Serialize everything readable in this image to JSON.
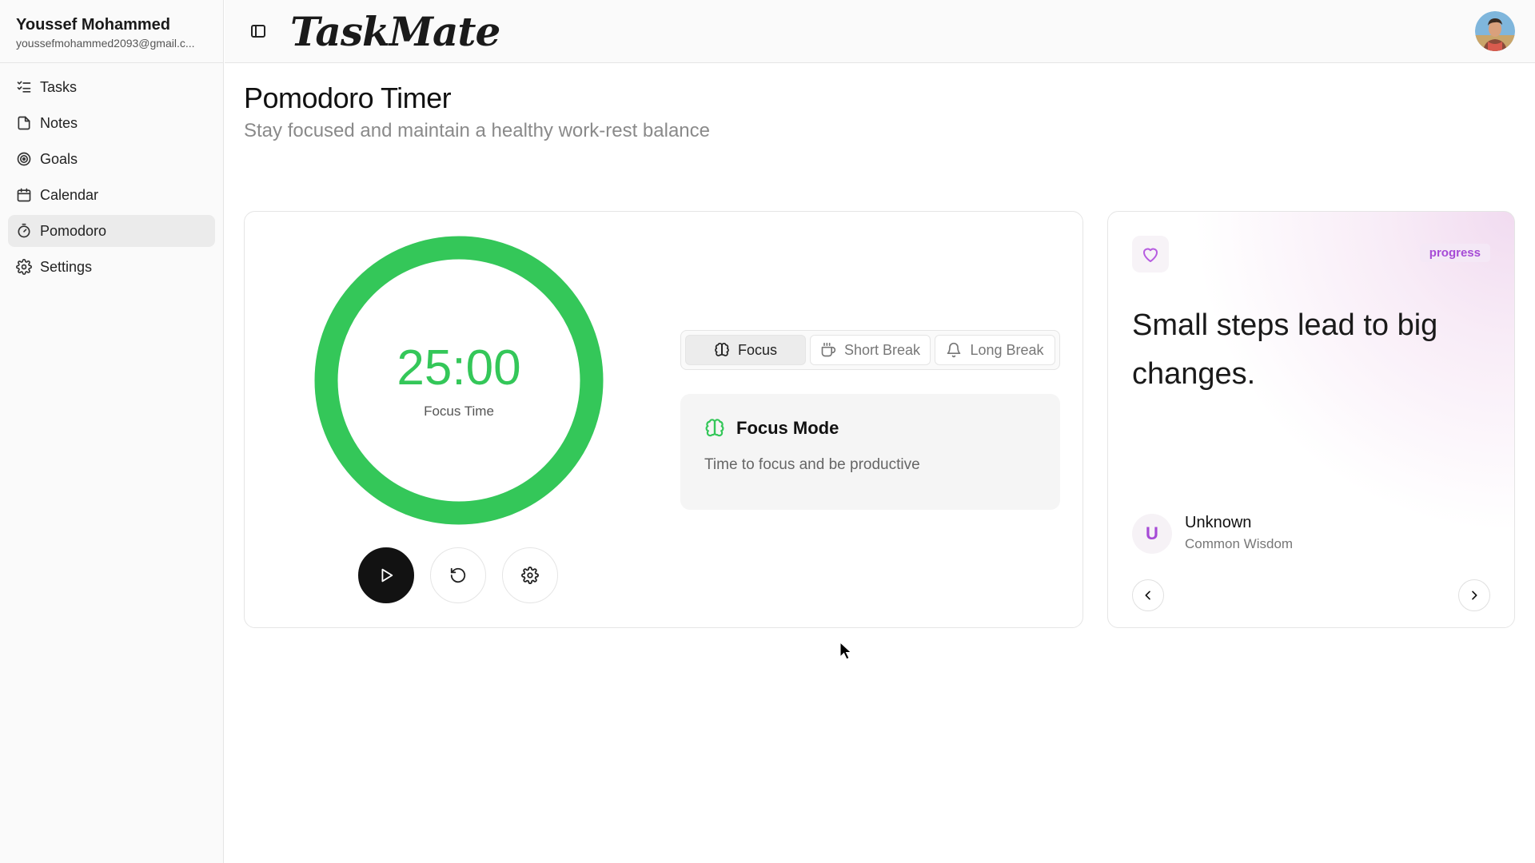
{
  "user": {
    "name": "Youssef Mohammed",
    "email": "youssefmohammed2093@gmail.c..."
  },
  "sidebar": {
    "items": [
      {
        "label": "Tasks",
        "icon": "list-check-icon",
        "active": false
      },
      {
        "label": "Notes",
        "icon": "file-icon",
        "active": false
      },
      {
        "label": "Goals",
        "icon": "target-icon",
        "active": false
      },
      {
        "label": "Calendar",
        "icon": "calendar-icon",
        "active": false
      },
      {
        "label": "Pomodoro",
        "icon": "timer-icon",
        "active": true
      },
      {
        "label": "Settings",
        "icon": "gear-icon",
        "active": false
      }
    ]
  },
  "header": {
    "logo": "TaskMate",
    "toggle_icon": "sidebar-toggle-icon",
    "avatar_icon": "user-avatar"
  },
  "page": {
    "title": "Pomodoro Timer",
    "subtitle": "Stay focused and maintain a healthy work-rest balance"
  },
  "timer": {
    "time": "25:00",
    "label": "Focus Time",
    "progress": 1.0,
    "ring_color": "#34c759",
    "controls": [
      "play-icon",
      "reset-icon",
      "gear-icon"
    ]
  },
  "modes": {
    "tabs": [
      {
        "label": "Focus",
        "icon": "brain-icon",
        "active": true
      },
      {
        "label": "Short Break",
        "icon": "coffee-icon",
        "active": false
      },
      {
        "label": "Long Break",
        "icon": "bell-icon",
        "active": false
      }
    ],
    "info": {
      "title": "Focus Mode",
      "description": "Time to focus and be productive",
      "icon": "brain-icon"
    }
  },
  "quote": {
    "tag": "progress",
    "text": "Small steps lead to big changes.",
    "author_initial": "U",
    "author": "Unknown",
    "source": "Common Wisdom",
    "accent_color": "#a64bd6"
  },
  "colors": {
    "accent_green": "#34c759",
    "accent_purple": "#a64bd6",
    "primary_dark": "#121212"
  }
}
